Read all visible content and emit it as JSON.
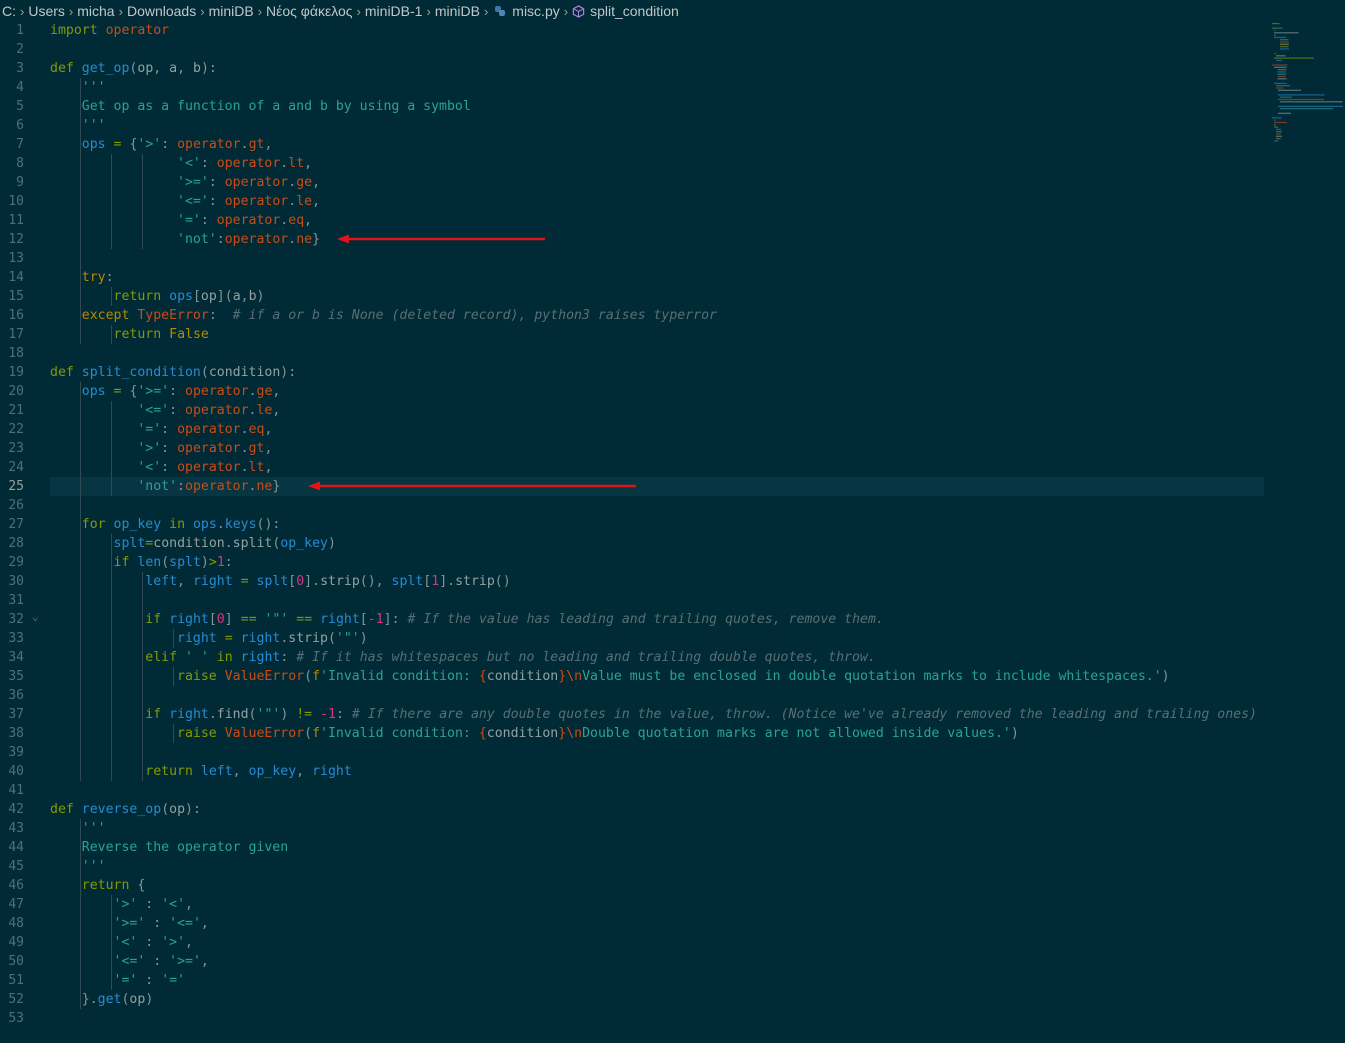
{
  "breadcrumb": {
    "items": [
      "C:",
      "Users",
      "micha",
      "Downloads",
      "miniDB",
      "Νέος φάκελος",
      "miniDB-1",
      "miniDB",
      "misc.py",
      "split_condition"
    ]
  },
  "editor": {
    "language": "python",
    "lines": [
      "import operator",
      "",
      "def get_op(op, a, b):",
      "    '''",
      "    Get op as a function of a and b by using a symbol",
      "    '''",
      "    ops = {'>': operator.gt,",
      "                '<': operator.lt,",
      "                '>=': operator.ge,",
      "                '<=': operator.le,",
      "                '=': operator.eq,",
      "                'not':operator.ne}",
      "",
      "    try:",
      "        return ops[op](a,b)",
      "    except TypeError:  # if a or b is None (deleted record), python3 raises typerror",
      "        return False",
      "",
      "def split_condition(condition):",
      "    ops = {'>=': operator.ge,",
      "           '<=': operator.le,",
      "           '=': operator.eq,",
      "           '>': operator.gt,",
      "           '<': operator.lt,",
      "           'not':operator.ne}",
      "",
      "    for op_key in ops.keys():",
      "        splt=condition.split(op_key)",
      "        if len(splt)>1:",
      "            left, right = splt[0].strip(), splt[1].strip()",
      "",
      "            if right[0] == '\"' == right[-1]: # If the value has leading and trailing quotes, remove them.",
      "                right = right.strip('\"')",
      "            elif ' ' in right: # If it has whitespaces but no leading and trailing double quotes, throw.",
      "                raise ValueError(f'Invalid condition: {condition}\\nValue must be enclosed in double quotation marks to include whitespaces.')",
      "",
      "            if right.find('\"') != -1: # If there are any double quotes in the value, throw. (Notice we've already removed the leading and trailing ones)",
      "                raise ValueError(f'Invalid condition: {condition}\\nDouble quotation marks are not allowed inside values.')",
      "",
      "            return left, op_key, right",
      "",
      "def reverse_op(op):",
      "    '''",
      "    Reverse the operator given",
      "    '''",
      "    return {",
      "        '>' : '<',",
      "        '>=' : '<=',",
      "        '<' : '>',",
      "        '<=' : '>=',",
      "        '=' : '='",
      "    }.get(op)",
      ""
    ],
    "highlighted_line": 25,
    "annotation_arrow_lines": [
      12,
      25
    ],
    "colors": {
      "background": "#002b36",
      "current_line": "#073642",
      "keyword": "#859900",
      "function": "#268bd2",
      "string": "#2aa198",
      "attribute": "#cb4b16",
      "comment": "#586e75",
      "arrow": "#e0131a"
    }
  }
}
